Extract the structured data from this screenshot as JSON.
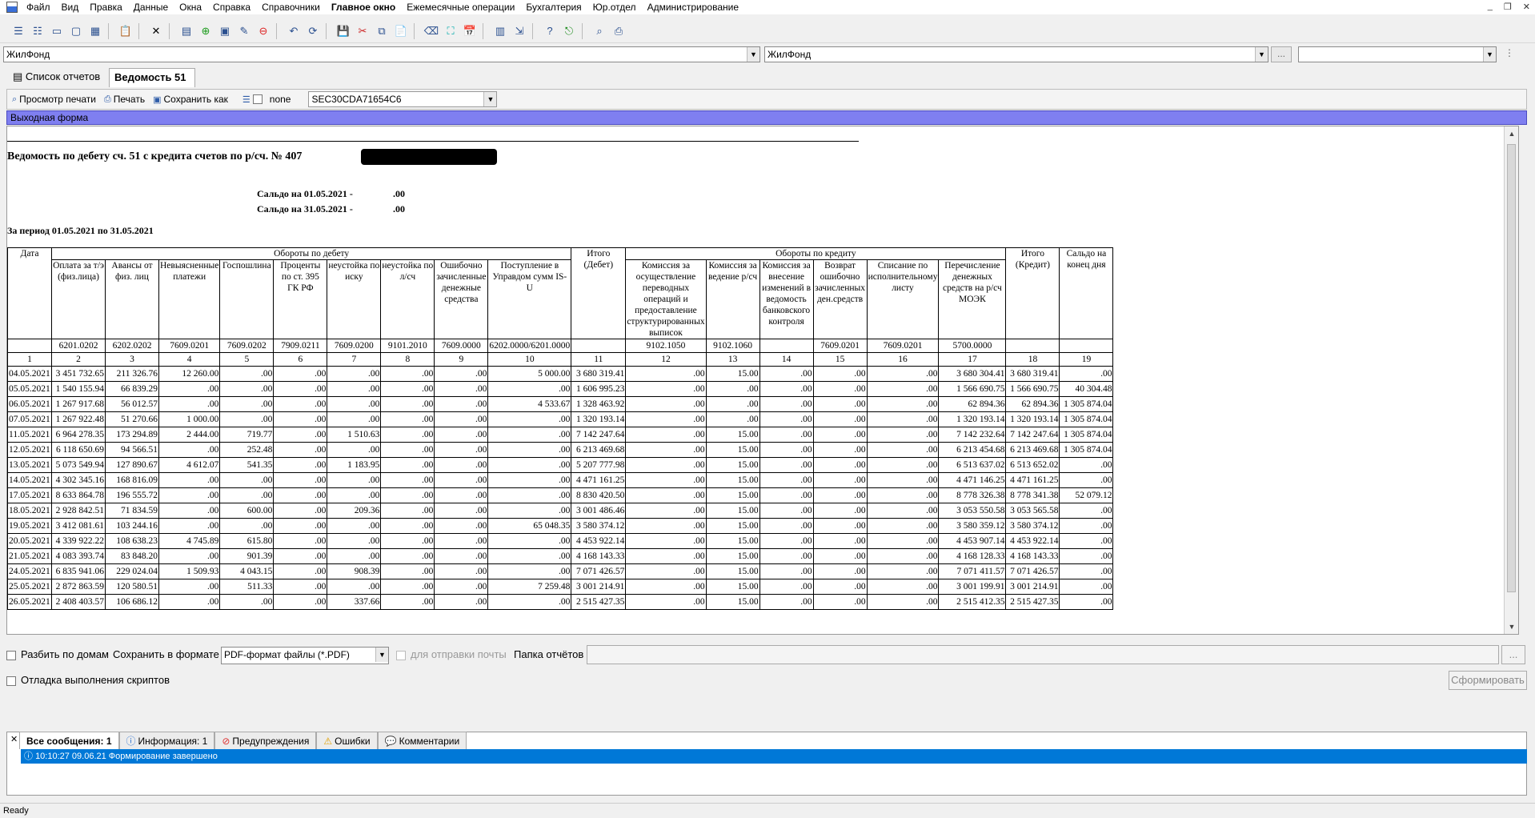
{
  "menu": [
    "Файл",
    "Вид",
    "Правка",
    "Данные",
    "Окна",
    "Справка",
    "Справочники",
    "Главное окно",
    "Ежемесячные операции",
    "Бухгалтерия",
    "Юр.отдел",
    "Администрирование"
  ],
  "org": {
    "left": "ЖилФонд",
    "right": "ЖилФонд",
    "browse": "..."
  },
  "tabs": {
    "list": "Список отчетов",
    "active": "Ведомость 51"
  },
  "report_toolbar": {
    "preview": "Просмотр печати",
    "print": "Печать",
    "save_as": "Сохранить как",
    "none": "none",
    "guid": "SEC30CDA71654C6"
  },
  "banner": "Выходная форма",
  "report": {
    "title": "Ведомость по дебету сч. 51 с кредита счетов по р/сч. №  407",
    "saldo_start_label": "Сальдо на 01.05.2021   -",
    "saldo_start_value": ".00",
    "saldo_end_label": "Сальдо на 31.05.2021   -",
    "saldo_end_value": ".00",
    "period": "За период  01.05.2021  по  31.05.2021"
  },
  "table": {
    "h_date": "Дата",
    "h_debit": "Обороты по дебету",
    "h_total_debit": "Итого (Дебет)",
    "h_credit": "Обороты по кредиту",
    "h_total_credit": "Итого (Кредит)",
    "h_saldo": "Сальдо на конец дня",
    "debit_cols": [
      "Оплата за т/э (физ.лица)",
      "Авансы от физ. лиц",
      "Невыясненные платежи",
      "Госпошлина",
      "Проценты по ст. 395 ГК РФ",
      "неустойка по иску",
      "неустойка по л/сч",
      "Ошибочно зачисленные денежные средства",
      "Поступление в Управдом сумм IS-U"
    ],
    "credit_cols": [
      "Комиссия за осуществление переводных операций и предоставление структурированных выписок",
      "Комиссия за ведение р/сч",
      "Комиссия за внесение изменений в ведомость банковского контроля",
      "Возврат ошибочно зачисленных ден.средств",
      "Списание по исполнительному листу",
      "Перечисление денежных средств на р/сч МОЭК"
    ],
    "codes": [
      "",
      "6201.0202",
      "6202.0202",
      "7609.0201",
      "7609.0202",
      "7909.0211",
      "7609.0200",
      "9101.2010",
      "7609.0000",
      "6202.0000/6201.0000",
      "",
      "9102.1050",
      "9102.1060",
      "",
      "7609.0201",
      "7609.0201",
      "5700.0000",
      "",
      ""
    ],
    "idx": [
      "1",
      "2",
      "3",
      "4",
      "5",
      "6",
      "7",
      "8",
      "9",
      "10",
      "11",
      "12",
      "13",
      "14",
      "15",
      "16",
      "17",
      "18",
      "19"
    ],
    "rows": [
      [
        "04.05.2021",
        "3 451 732.65",
        "211 326.76",
        "12 260.00",
        ".00",
        ".00",
        ".00",
        ".00",
        ".00",
        "5 000.00",
        "3 680 319.41",
        ".00",
        "15.00",
        ".00",
        ".00",
        ".00",
        "3 680 304.41",
        "3 680 319.41",
        ".00"
      ],
      [
        "05.05.2021",
        "1 540 155.94",
        "66 839.29",
        ".00",
        ".00",
        ".00",
        ".00",
        ".00",
        ".00",
        ".00",
        "1 606 995.23",
        ".00",
        ".00",
        ".00",
        ".00",
        ".00",
        "1 566 690.75",
        "1 566 690.75",
        "40 304.48"
      ],
      [
        "06.05.2021",
        "1 267 917.68",
        "56 012.57",
        ".00",
        ".00",
        ".00",
        ".00",
        ".00",
        ".00",
        "4 533.67",
        "1 328 463.92",
        ".00",
        ".00",
        ".00",
        ".00",
        ".00",
        "62 894.36",
        "62 894.36",
        "1 305 874.04"
      ],
      [
        "07.05.2021",
        "1 267 922.48",
        "51 270.66",
        "1 000.00",
        ".00",
        ".00",
        ".00",
        ".00",
        ".00",
        ".00",
        "1 320 193.14",
        ".00",
        ".00",
        ".00",
        ".00",
        ".00",
        "1 320 193.14",
        "1 320 193.14",
        "1 305 874.04"
      ],
      [
        "11.05.2021",
        "6 964 278.35",
        "173 294.89",
        "2 444.00",
        "719.77",
        ".00",
        "1 510.63",
        ".00",
        ".00",
        ".00",
        "7 142 247.64",
        ".00",
        "15.00",
        ".00",
        ".00",
        ".00",
        "7 142 232.64",
        "7 142 247.64",
        "1 305 874.04"
      ],
      [
        "12.05.2021",
        "6 118 650.69",
        "94 566.51",
        ".00",
        "252.48",
        ".00",
        ".00",
        ".00",
        ".00",
        ".00",
        "6 213 469.68",
        ".00",
        "15.00",
        ".00",
        ".00",
        ".00",
        "6 213 454.68",
        "6 213 469.68",
        "1 305 874.04"
      ],
      [
        "13.05.2021",
        "5 073 549.94",
        "127 890.67",
        "4 612.07",
        "541.35",
        ".00",
        "1 183.95",
        ".00",
        ".00",
        ".00",
        "5 207 777.98",
        ".00",
        "15.00",
        ".00",
        ".00",
        ".00",
        "6 513 637.02",
        "6 513 652.02",
        ".00"
      ],
      [
        "14.05.2021",
        "4 302 345.16",
        "168 816.09",
        ".00",
        ".00",
        ".00",
        ".00",
        ".00",
        ".00",
        ".00",
        "4 471 161.25",
        ".00",
        "15.00",
        ".00",
        ".00",
        ".00",
        "4 471 146.25",
        "4 471 161.25",
        ".00"
      ],
      [
        "17.05.2021",
        "8 633 864.78",
        "196 555.72",
        ".00",
        ".00",
        ".00",
        ".00",
        ".00",
        ".00",
        ".00",
        "8 830 420.50",
        ".00",
        "15.00",
        ".00",
        ".00",
        ".00",
        "8 778 326.38",
        "8 778 341.38",
        "52 079.12"
      ],
      [
        "18.05.2021",
        "2 928 842.51",
        "71 834.59",
        ".00",
        "600.00",
        ".00",
        "209.36",
        ".00",
        ".00",
        ".00",
        "3 001 486.46",
        ".00",
        "15.00",
        ".00",
        ".00",
        ".00",
        "3 053 550.58",
        "3 053 565.58",
        ".00"
      ],
      [
        "19.05.2021",
        "3 412 081.61",
        "103 244.16",
        ".00",
        ".00",
        ".00",
        ".00",
        ".00",
        ".00",
        "65 048.35",
        "3 580 374.12",
        ".00",
        "15.00",
        ".00",
        ".00",
        ".00",
        "3 580 359.12",
        "3 580 374.12",
        ".00"
      ],
      [
        "20.05.2021",
        "4 339 922.22",
        "108 638.23",
        "4 745.89",
        "615.80",
        ".00",
        ".00",
        ".00",
        ".00",
        ".00",
        "4 453 922.14",
        ".00",
        "15.00",
        ".00",
        ".00",
        ".00",
        "4 453 907.14",
        "4 453 922.14",
        ".00"
      ],
      [
        "21.05.2021",
        "4 083 393.74",
        "83 848.20",
        ".00",
        "901.39",
        ".00",
        ".00",
        ".00",
        ".00",
        ".00",
        "4 168 143.33",
        ".00",
        "15.00",
        ".00",
        ".00",
        ".00",
        "4 168 128.33",
        "4 168 143.33",
        ".00"
      ],
      [
        "24.05.2021",
        "6 835 941.06",
        "229 024.04",
        "1 509.93",
        "4 043.15",
        ".00",
        "908.39",
        ".00",
        ".00",
        ".00",
        "7 071 426.57",
        ".00",
        "15.00",
        ".00",
        ".00",
        ".00",
        "7 071 411.57",
        "7 071 426.57",
        ".00"
      ],
      [
        "25.05.2021",
        "2 872 863.59",
        "120 580.51",
        ".00",
        "511.33",
        ".00",
        ".00",
        ".00",
        ".00",
        "7 259.48",
        "3 001 214.91",
        ".00",
        "15.00",
        ".00",
        ".00",
        ".00",
        "3 001 199.91",
        "3 001 214.91",
        ".00"
      ],
      [
        "26.05.2021",
        "2 408 403.57",
        "106 686.12",
        ".00",
        ".00",
        ".00",
        "337.66",
        ".00",
        ".00",
        ".00",
        "2 515 427.35",
        ".00",
        "15.00",
        ".00",
        ".00",
        ".00",
        "2 515 412.35",
        "2 515 427.35",
        ".00"
      ]
    ]
  },
  "options": {
    "split_by_house": "Разбить по домам",
    "save_format_label": "Сохранить в формате",
    "save_format": "PDF-формат файлы (*.PDF)",
    "for_mail": "для отправки почты",
    "folder_label": "Папка отчётов",
    "folder_browse": "...",
    "debug": "Отладка выполнения скриптов",
    "build": "Сформировать"
  },
  "messages": {
    "tabs": [
      "Все сообщения: 1",
      "Информация: 1",
      "Предупреждения",
      "Ошибки",
      "Комментарии"
    ],
    "row": "10:10:27 09.06.21 Формирование завершено"
  },
  "status": "Ready"
}
